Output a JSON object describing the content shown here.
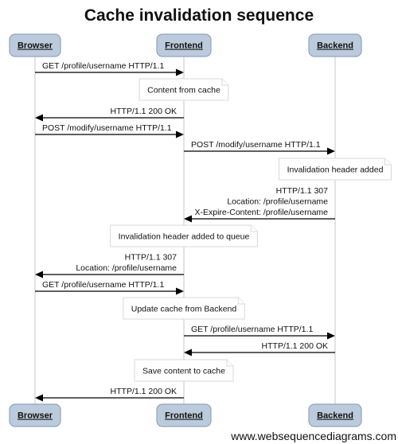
{
  "title": "Cache invalidation sequence",
  "watermark": "www.websequencediagrams.com",
  "colors": {
    "actor_fill": "#bccbdc",
    "actor_stroke": "#8fa3bd",
    "lifeline": "#d0d0d0",
    "note_border": "#d8d8d8"
  },
  "participants": [
    {
      "id": "browser",
      "label": "Browser"
    },
    {
      "id": "frontend",
      "label": "Frontend"
    },
    {
      "id": "backend",
      "label": "Backend"
    }
  ],
  "steps": [
    {
      "type": "message",
      "from": "browser",
      "to": "frontend",
      "lines": [
        "GET /profile/username HTTP/1.1"
      ]
    },
    {
      "type": "note",
      "over": "frontend",
      "text": "Content from cache"
    },
    {
      "type": "message",
      "from": "frontend",
      "to": "browser",
      "lines": [
        "HTTP/1.1 200 OK"
      ]
    },
    {
      "type": "message",
      "from": "browser",
      "to": "frontend",
      "lines": [
        "POST /modify/username HTTP/1.1"
      ]
    },
    {
      "type": "message",
      "from": "frontend",
      "to": "backend",
      "lines": [
        "POST /modify/username HTTP/1.1"
      ]
    },
    {
      "type": "note",
      "over": "backend",
      "text": "Invalidation header added"
    },
    {
      "type": "message",
      "from": "backend",
      "to": "frontend",
      "lines": [
        "HTTP/1.1 307",
        "Location: /profile/username",
        "X-Expire-Content: /profile/username"
      ]
    },
    {
      "type": "note",
      "over": "frontend",
      "text": "Invalidation header added to queue"
    },
    {
      "type": "message",
      "from": "frontend",
      "to": "browser",
      "lines": [
        "HTTP/1.1 307",
        "Location: /profile/username"
      ]
    },
    {
      "type": "message",
      "from": "browser",
      "to": "frontend",
      "lines": [
        "GET /profile/username HTTP/1.1"
      ]
    },
    {
      "type": "note",
      "over": "frontend",
      "text": "Update cache from Backend"
    },
    {
      "type": "message",
      "from": "frontend",
      "to": "backend",
      "lines": [
        "GET /profile/username HTTP/1.1"
      ]
    },
    {
      "type": "message",
      "from": "backend",
      "to": "frontend",
      "lines": [
        "HTTP/1.1 200 OK"
      ]
    },
    {
      "type": "note",
      "over": "frontend",
      "text": "Save content to cache"
    },
    {
      "type": "message",
      "from": "frontend",
      "to": "browser",
      "lines": [
        "HTTP/1.1 200 OK"
      ]
    }
  ]
}
